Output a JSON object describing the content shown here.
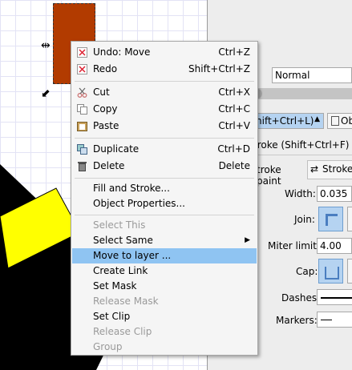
{
  "panel": {
    "blend_value": "Normal",
    "shortcut_fill": "hift+Ctrl+L)",
    "ob_label": "Ob",
    "stroke_shortcut": "troke (Shift+Ctrl+F)",
    "tab_stroke_paint": "troke paint",
    "tab_stroke_style": "Stroke",
    "width_label": "Width:",
    "width_value": "0.035",
    "join_label": "Join:",
    "miter_label": "Miter limit:",
    "miter_value": "4.00",
    "cap_label": "Cap:",
    "dashes_label": "Dashes:",
    "markers_label": "Markers:"
  },
  "menu": {
    "items": [
      {
        "label": "Undo: Move",
        "accel": "Ctrl+Z",
        "icon": "undo-icon"
      },
      {
        "label": "Redo",
        "accel": "Shift+Ctrl+Z",
        "icon": "redo-icon"
      },
      {
        "label": "Cut",
        "accel": "Ctrl+X",
        "icon": "cut-icon"
      },
      {
        "label": "Copy",
        "accel": "Ctrl+C",
        "icon": "copy-icon"
      },
      {
        "label": "Paste",
        "accel": "Ctrl+V",
        "icon": "paste-icon"
      },
      {
        "label": "Duplicate",
        "accel": "Ctrl+D",
        "icon": "duplicate-icon"
      },
      {
        "label": "Delete",
        "accel": "Delete",
        "icon": "trash-icon"
      },
      {
        "label": "Fill and Stroke...",
        "accel": ""
      },
      {
        "label": "Object Properties...",
        "accel": ""
      },
      {
        "label": "Select This",
        "accel": ""
      },
      {
        "label": "Select Same",
        "accel": ""
      },
      {
        "label": "Move to layer ...",
        "accel": ""
      },
      {
        "label": "Create Link",
        "accel": ""
      },
      {
        "label": "Set Mask",
        "accel": ""
      },
      {
        "label": "Release Mask",
        "accel": ""
      },
      {
        "label": "Set Clip",
        "accel": ""
      },
      {
        "label": "Release Clip",
        "accel": ""
      },
      {
        "label": "Group",
        "accel": ""
      }
    ]
  },
  "colors": {
    "selected_rect": "#b23b00",
    "highlight": "#8fc4f2",
    "yellow_shape": "#ffff00"
  }
}
